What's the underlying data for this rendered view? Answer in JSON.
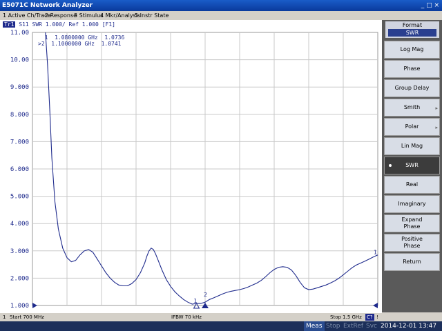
{
  "window": {
    "title": "E5071C Network Analyzer",
    "controls": "_ □ ×"
  },
  "menu": [
    "1 Active Ch/Trace",
    "2 Response",
    "3 Stimulus",
    "4 Mkr/Analysis",
    "5 Instr State"
  ],
  "trace_header": {
    "badge": "Tr1",
    "text": "S11  SWR 1.000/  Ref 1.000  [F1]"
  },
  "markers": [
    {
      "num": "1",
      "freq": "1.0800000 GHz",
      "value": "1.0736"
    },
    {
      "num": "2",
      "freq": "1.1000000 GHz",
      "value": "1.0741",
      "active_prefix": ">"
    }
  ],
  "marker_labels": {
    "right_end": "1",
    "m1": "1",
    "m2": "2"
  },
  "softkeys": {
    "header_label": "Format",
    "header_value": "SWR",
    "items": [
      {
        "label": "Log Mag"
      },
      {
        "label": "Phase"
      },
      {
        "label": "Group Delay"
      },
      {
        "label": "Smith",
        "arrow": "▸"
      },
      {
        "label": "Polar",
        "arrow": "▸"
      },
      {
        "label": "Lin Mag"
      },
      {
        "label": "SWR",
        "active": true
      },
      {
        "label": "Real"
      },
      {
        "label": "Imaginary"
      },
      {
        "label": "Expand Phase"
      },
      {
        "label": "Positive Phase"
      },
      {
        "label": "Return"
      }
    ]
  },
  "status": {
    "channel": "1",
    "start": "Start 700 MHz",
    "ifbw": "IFBW 70 kHz",
    "stop": "Stop 1.5 GHz",
    "cal": "C?",
    "marker": "!"
  },
  "bottom": {
    "meas": "Meas",
    "stop": "Stop",
    "extref": "ExtRef",
    "svc": "Svc",
    "datetime": "2014-12-01 13:47"
  },
  "chart_data": {
    "type": "line",
    "x_label_start": "Start 700 MHz",
    "x_label_stop": "Stop 1.5 GHz",
    "xlim_mhz": [
      700,
      1500
    ],
    "ylim": [
      1.0,
      11.0
    ],
    "yticks": [
      "11.00",
      "10.00",
      "9.000",
      "8.000",
      "7.000",
      "6.000",
      "5.000",
      "4.000",
      "3.000",
      "2.000",
      "1.000"
    ],
    "series": [
      {
        "color": "#1e2a8c",
        "x": [
          730,
          735,
          740,
          745,
          752,
          760,
          770,
          780,
          790,
          800,
          810,
          820,
          830,
          840,
          850,
          860,
          870,
          880,
          890,
          900,
          910,
          920,
          930,
          940,
          950,
          960,
          965,
          970,
          975,
          980,
          985,
          990,
          1000,
          1010,
          1020,
          1030,
          1040,
          1050,
          1060,
          1070,
          1080,
          1090,
          1100,
          1110,
          1120,
          1130,
          1140,
          1150,
          1160,
          1170,
          1180,
          1190,
          1200,
          1210,
          1220,
          1230,
          1240,
          1250,
          1260,
          1270,
          1280,
          1290,
          1300,
          1310,
          1320,
          1330,
          1340,
          1350,
          1360,
          1370,
          1380,
          1390,
          1400,
          1410,
          1420,
          1430,
          1440,
          1450,
          1460,
          1470,
          1480,
          1490,
          1500
        ],
        "y": [
          11.0,
          9.8,
          8.2,
          6.4,
          4.8,
          3.8,
          3.1,
          2.75,
          2.6,
          2.65,
          2.85,
          3.0,
          3.05,
          2.95,
          2.7,
          2.45,
          2.2,
          2.0,
          1.85,
          1.75,
          1.72,
          1.72,
          1.8,
          1.95,
          2.2,
          2.55,
          2.8,
          3.0,
          3.1,
          3.05,
          2.9,
          2.7,
          2.3,
          1.95,
          1.7,
          1.5,
          1.35,
          1.22,
          1.12,
          1.05,
          1.0736,
          1.0741,
          1.12,
          1.22,
          1.28,
          1.35,
          1.42,
          1.48,
          1.52,
          1.55,
          1.58,
          1.62,
          1.68,
          1.75,
          1.82,
          1.92,
          2.05,
          2.2,
          2.32,
          2.4,
          2.42,
          2.4,
          2.3,
          2.1,
          1.85,
          1.65,
          1.58,
          1.6,
          1.65,
          1.7,
          1.75,
          1.82,
          1.9,
          2.0,
          2.12,
          2.25,
          2.38,
          2.48,
          2.55,
          2.62,
          2.7,
          2.78,
          2.85
        ]
      }
    ]
  }
}
